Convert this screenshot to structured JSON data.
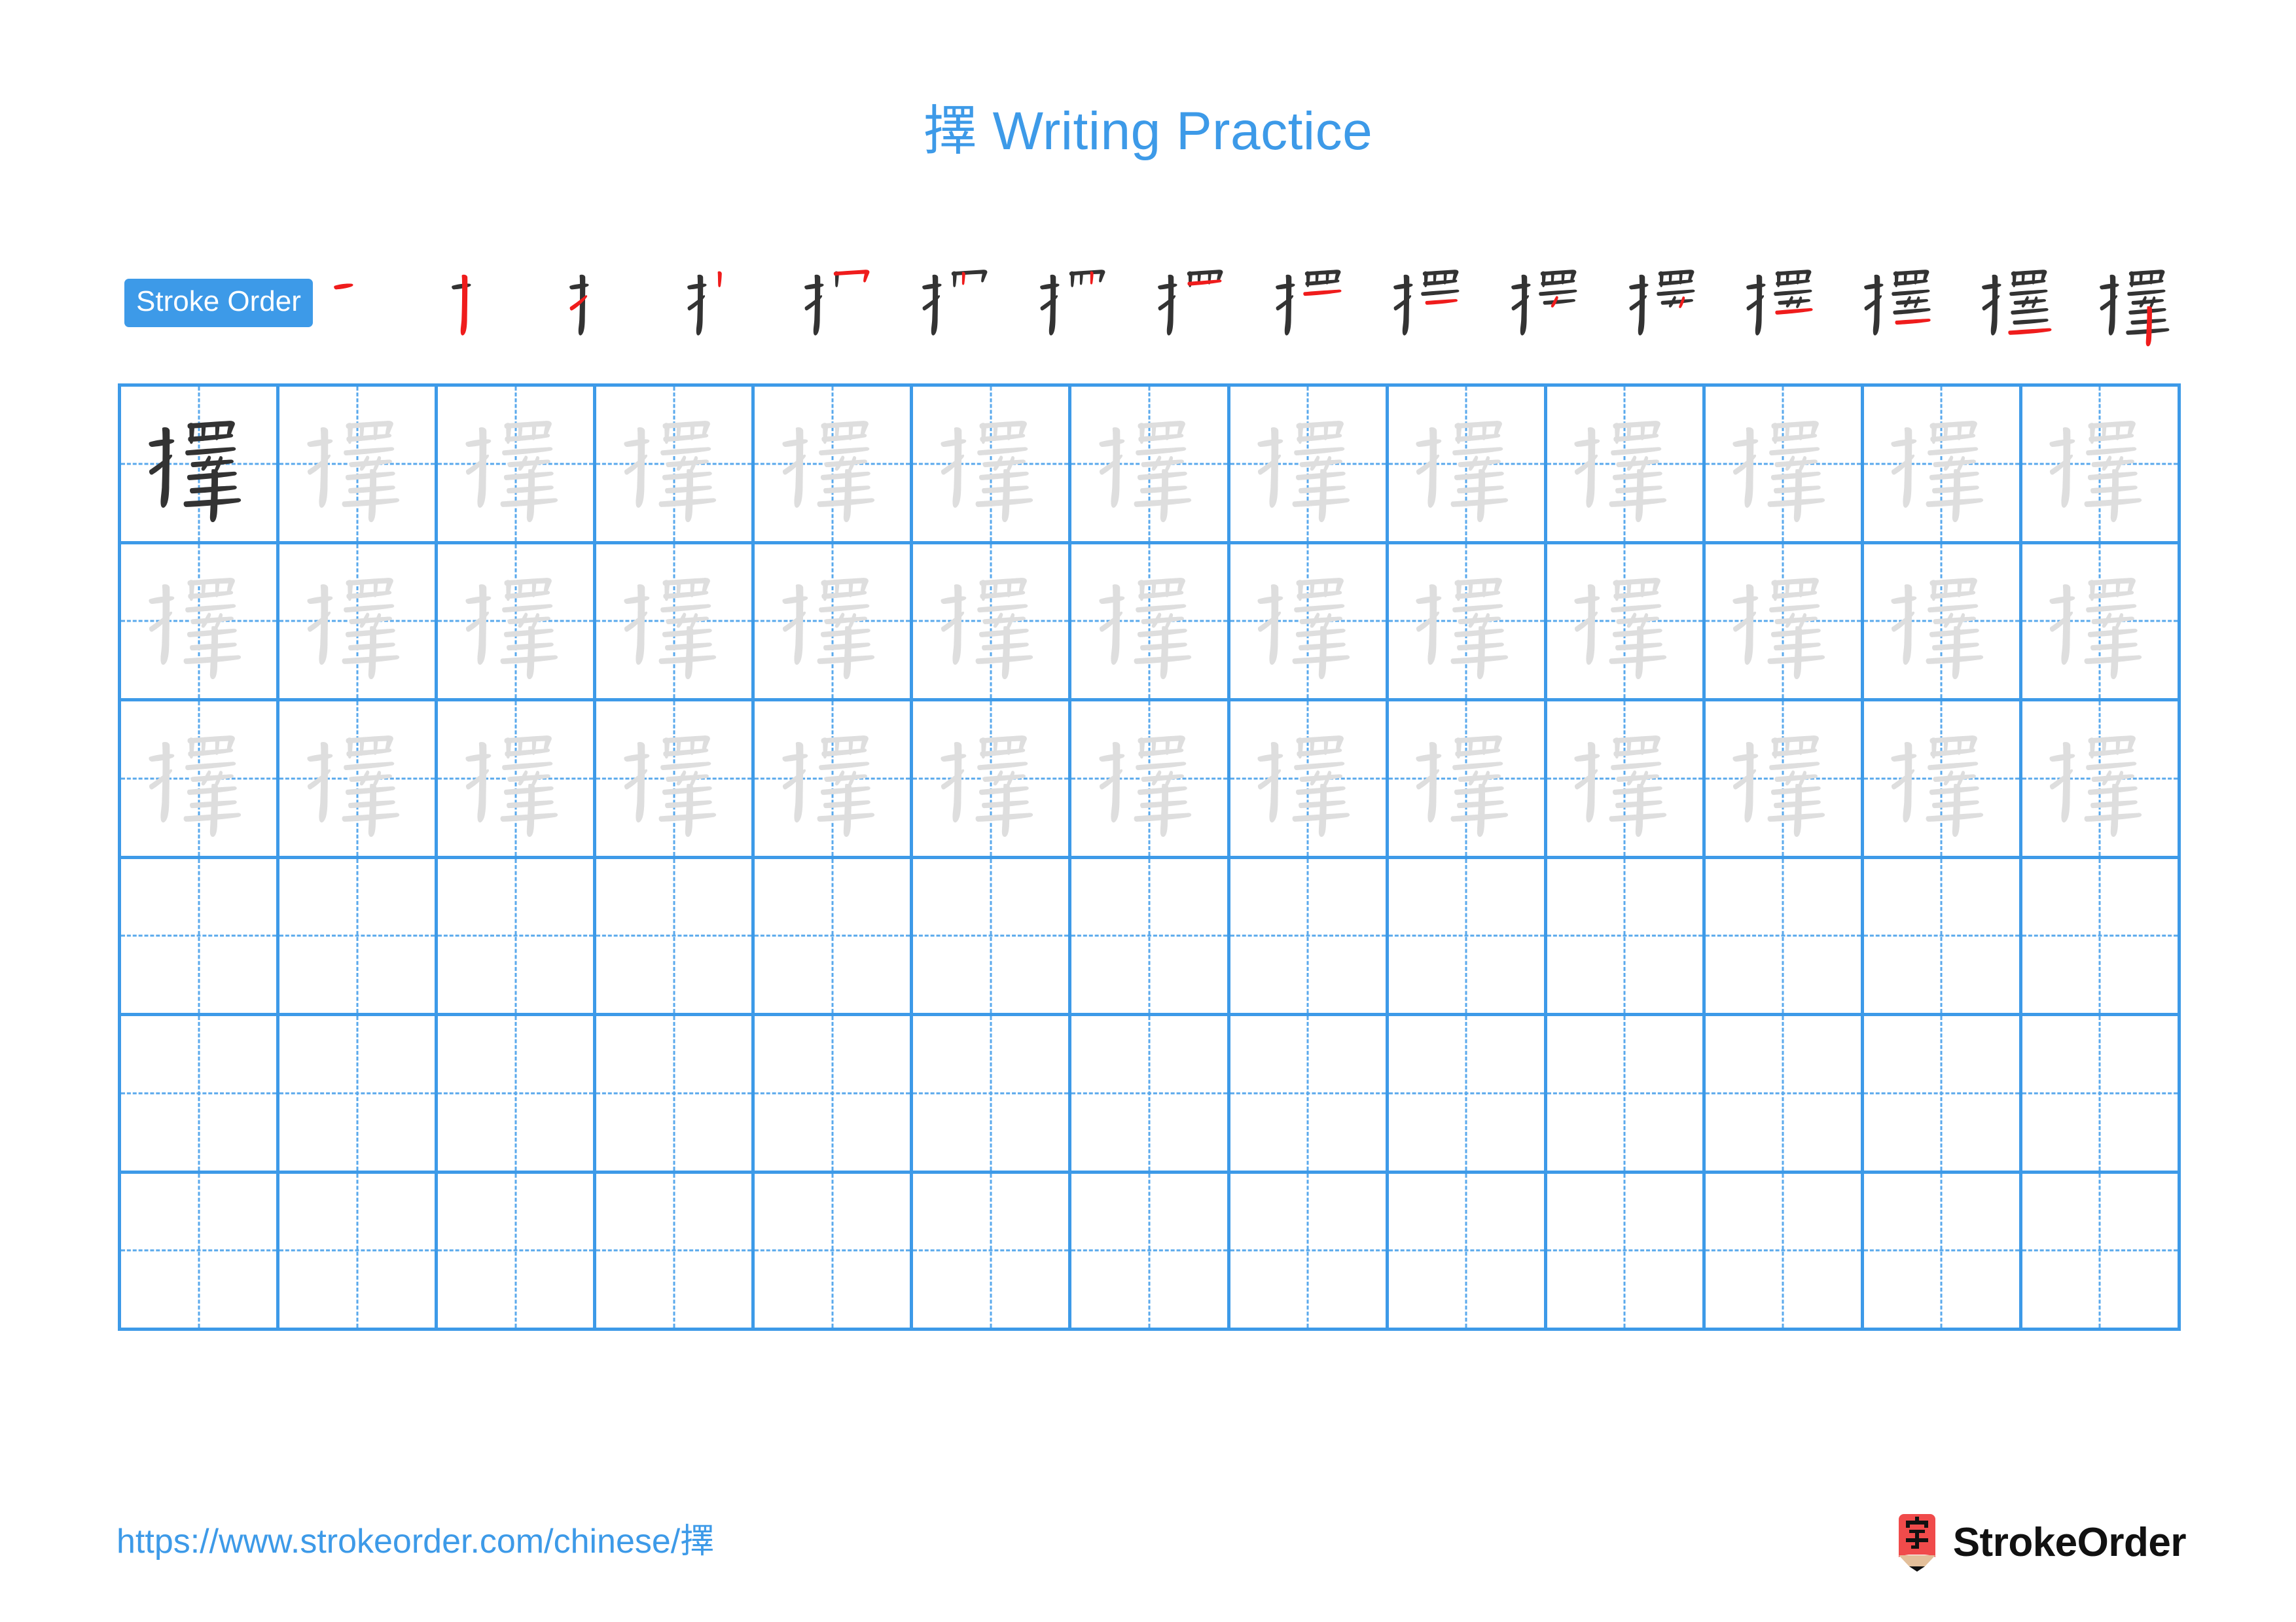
{
  "character": "擇",
  "title": "擇 Writing Practice",
  "stroke_order": {
    "badge_label": "Stroke Order",
    "total_strokes": 16,
    "steps": [
      1,
      2,
      3,
      4,
      5,
      6,
      7,
      8,
      9,
      10,
      11,
      12,
      13,
      14,
      15,
      16
    ],
    "new_stroke_color": "#ef1c1c",
    "existing_stroke_color": "#333333"
  },
  "practice_grid": {
    "columns": 13,
    "rows": 6,
    "grid_line_color": "#3d9ae8",
    "guide_line_color": "#5aa9ec",
    "model_character_color": "#333333",
    "trace_character_color": "#dedede",
    "row_fill": [
      "model-then-trace",
      "trace",
      "trace",
      "empty",
      "empty",
      "empty"
    ]
  },
  "footer": {
    "url": "https://www.strokeorder.com/chinese/擇",
    "brand_name": "StrokeOrder",
    "brand_mark_character": "字",
    "brand_mark_color": "#f04b4b",
    "brand_mark_wood_color": "#e3bf9a"
  },
  "colors": {
    "accent_blue": "#3d9ae8",
    "title_blue": "#4a9ff0",
    "red": "#ef1c1c",
    "dark": "#333333",
    "light_gray": "#dedede"
  }
}
